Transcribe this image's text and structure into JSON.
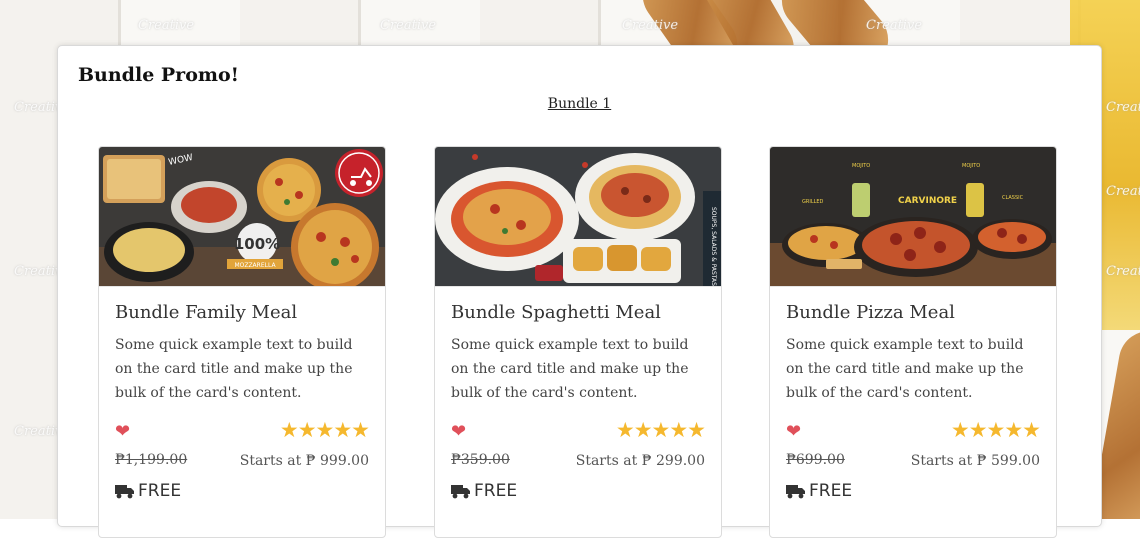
{
  "page": {
    "heading": "Bundle Promo!",
    "tab_link": "Bundle 1",
    "watermark": "Creative"
  },
  "colors": {
    "heart": "#e0505a",
    "star": "#f5b82e",
    "text": "#444444"
  },
  "icons": {
    "favorite": "heart-icon",
    "rating": "star-icon",
    "shipping": "truck-icon"
  },
  "cards": [
    {
      "title": "Bundle Family Meal",
      "text": "Some quick example text to build on the card title and make up the bulk of the card's content.",
      "rating": 5,
      "old_price": "₱1,199.00",
      "price": "Starts at ₱ 999.00",
      "shipping": "FREE",
      "image_badge": "FOOD DELIVERY",
      "image_text": "100% MOZZARELLA CHEESE"
    },
    {
      "title": "Bundle Spaghetti Meal",
      "text": "Some quick example text to build on the card title and make up the bulk of the card's content.",
      "rating": 5,
      "old_price": "₱359.00",
      "price": "Starts at ₱ 299.00",
      "shipping": "FREE",
      "image_side_text": "SOUPS, SALADS & PASTAS"
    },
    {
      "title": "Bundle Pizza Meal",
      "text": "Some quick example text to build on the card title and make up the bulk of the card's content.",
      "rating": 5,
      "old_price": "₱699.00",
      "price": "Starts at ₱ 599.00",
      "shipping": "FREE",
      "image_labels": [
        "MOJITO GINGER & KIWI",
        "MOJITO PASSION FRUIT",
        "GRILLED CHEEKY CHICKEN",
        "CARVINORE",
        "CLASSIC PEPPERONI",
        "BREAD STICKS"
      ]
    }
  ]
}
